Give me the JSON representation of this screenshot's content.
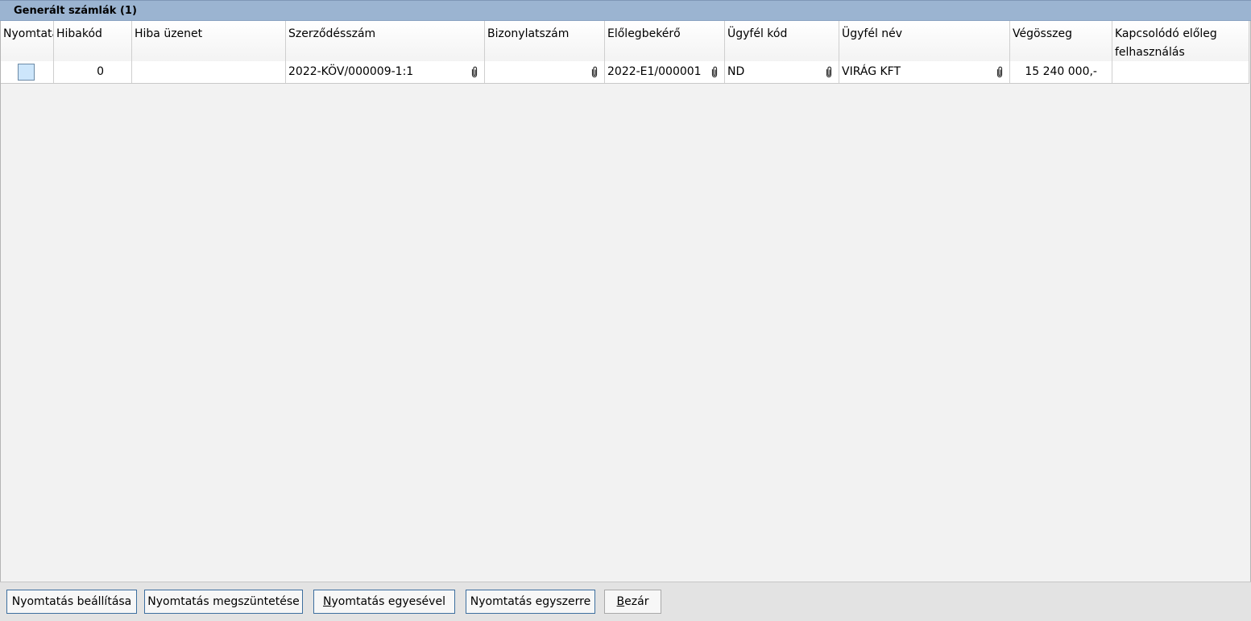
{
  "panel": {
    "title": "Generált számlák (1)"
  },
  "table": {
    "headers": {
      "print": "Nyomtatás",
      "error_code": "Hibakód",
      "error_message": "Hiba üzenet",
      "contract_number": "Szerződésszám",
      "document_number": "Bizonylatszám",
      "advance_request": "Előlegbekérő",
      "customer_code": "Ügyfél kód",
      "customer_name": "Ügyfél név",
      "total": "Végösszeg",
      "related_advance": "Kapcsolódó előleg felhasználás"
    },
    "rows": [
      {
        "print_checked": false,
        "error_code": "0",
        "error_message": "",
        "contract_number": "2022-KÖV/000009-1:1",
        "document_number": "",
        "advance_request": "2022-E1/000001",
        "customer_code": "ND",
        "customer_name": "VIRÁG KFT",
        "total": "15 240 000,-",
        "related_advance": ""
      }
    ]
  },
  "footer": {
    "print_settings_label": "Nyomtatás beállítása",
    "cancel_print_label": "Nyomtatás megszüntetése",
    "print_individually_prefix": "N",
    "print_individually_rest": "yomtatás egyesével",
    "print_at_once_label": "Nyomtatás egyszerre",
    "close_prefix": "B",
    "close_rest": "ezár"
  },
  "colors": {
    "title_bar": "#9bb4d1",
    "checkbox_fill": "#cde6fb",
    "button_border": "#3d6f9f"
  },
  "icons": {
    "attachment": "paperclip-icon"
  }
}
